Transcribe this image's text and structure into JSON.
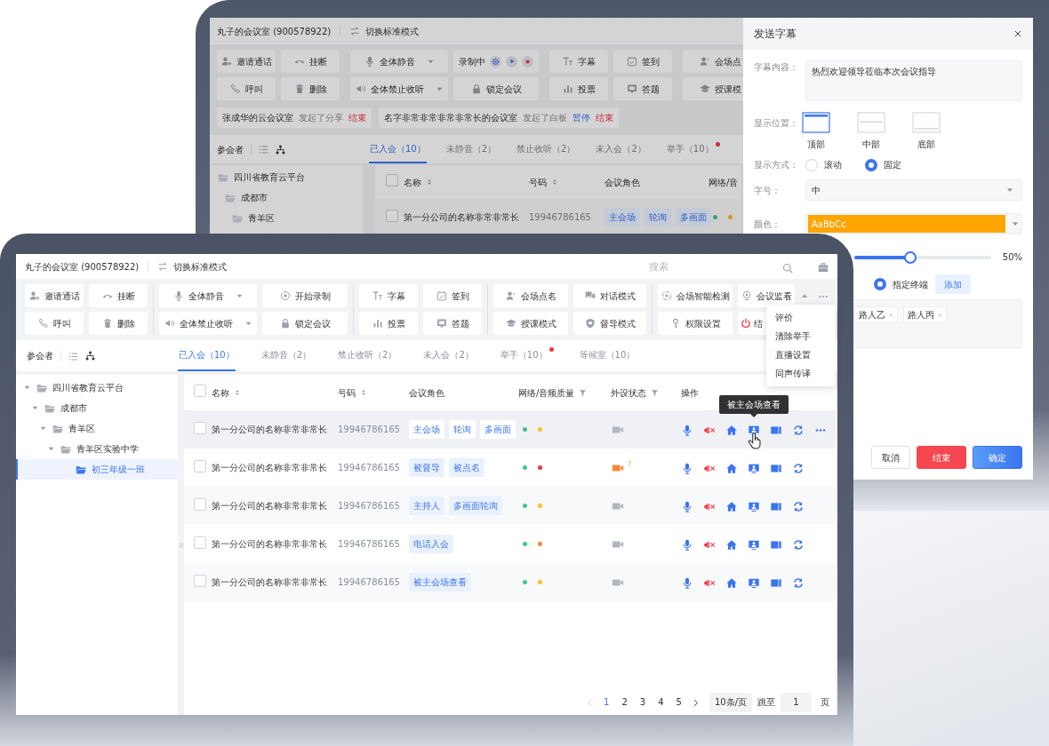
{
  "back_window": {
    "title": "丸子的会议室 (900578922)",
    "mode_switch": "切换标准模式",
    "toolbar": [
      {
        "rows": [
          [
            {
              "label": "邀请通话",
              "kind": "plain"
            },
            {
              "label": "挂断",
              "kind": "plain"
            }
          ],
          [
            {
              "label": "呼叫",
              "kind": "plain"
            },
            {
              "label": "删除",
              "kind": "plain"
            }
          ]
        ]
      },
      {
        "rows": [
          [
            {
              "label": "全体静音",
              "kind": "dropdown"
            },
            {
              "label": "录制中",
              "kind": "recording"
            }
          ],
          [
            {
              "label": "全体禁止收听",
              "kind": "dropdown"
            },
            {
              "label": "锁定会议",
              "kind": "plain"
            }
          ]
        ]
      },
      {
        "rows": [
          [
            {
              "label": "字幕",
              "kind": "plain"
            },
            {
              "label": "签到",
              "kind": "plain"
            }
          ],
          [
            {
              "label": "投票",
              "kind": "plain"
            },
            {
              "label": "答题",
              "kind": "plain"
            }
          ]
        ]
      },
      {
        "rows": [
          [
            {
              "label": "会场点",
              "kind": "plain"
            }
          ],
          [
            {
              "label": "授课模",
              "kind": "plain"
            }
          ]
        ]
      }
    ],
    "notices": [
      {
        "parts": [
          {
            "text": "张成华的云会议室",
            "kind": "name"
          },
          {
            "text": "发起了分享",
            "kind": "action"
          },
          {
            "text": "结束",
            "kind": "danger"
          }
        ]
      },
      {
        "parts": [
          {
            "text": "名字非常非常非常非常长的会议室",
            "kind": "name"
          },
          {
            "text": "发起了白板",
            "kind": "action"
          },
          {
            "text": "暂停",
            "kind": "link"
          },
          {
            "text": "结束",
            "kind": "danger"
          }
        ]
      }
    ],
    "participants_label": "参会者",
    "tabs": [
      {
        "label": "已入会（10）",
        "selected": true,
        "dot": false
      },
      {
        "label": "未静音（2）",
        "selected": false,
        "dot": false
      },
      {
        "label": "禁止收听（2）",
        "selected": false,
        "dot": false
      },
      {
        "label": "未入会（2）",
        "selected": false,
        "dot": false
      },
      {
        "label": "举手（10）",
        "selected": false,
        "dot": true
      }
    ],
    "tree": [
      {
        "label": "四川省教育云平台",
        "selected": false,
        "children": [
          {
            "label": "成都市",
            "selected": false,
            "children": [
              {
                "label": "青羊区",
                "selected": false
              }
            ]
          }
        ]
      }
    ],
    "table": {
      "all_checked": false,
      "columns": [
        {
          "label": "名称",
          "sort": true,
          "filter": false
        },
        {
          "label": "号码",
          "sort": true,
          "filter": false
        },
        {
          "label": "会议角色",
          "sort": false,
          "filter": false
        },
        {
          "label": "网络/音",
          "sort": false,
          "filter": false
        }
      ],
      "rows": [
        {
          "checked": false,
          "name": "第一分公司的名称非常非常长",
          "number": "19946786165",
          "roles": [
            "主会场",
            "轮询",
            "多画面"
          ],
          "quality": [
            {
              "color": "#33a474"
            },
            {
              "color": "#cf9c1c"
            }
          ]
        }
      ]
    },
    "drawer": {
      "title": "发送字幕",
      "content": {
        "label": "字幕内容：",
        "value": "热烈欢迎领导莅临本次会议指导"
      },
      "position": {
        "label": "显示位置：",
        "options": [
          {
            "label": "顶部",
            "selected": true
          },
          {
            "label": "中部",
            "selected": false
          },
          {
            "label": "底部",
            "selected": false
          }
        ]
      },
      "mode": {
        "label": "显示方式：",
        "options": [
          {
            "label": "滚动",
            "selected": false
          },
          {
            "label": "固定",
            "selected": true
          }
        ]
      },
      "size": {
        "label": "字号：",
        "value": "中"
      },
      "color": {
        "label": "颜色：",
        "value": "AaBbCc",
        "color": "#ffa500"
      },
      "opacity": {
        "level": 0.41,
        "reading": "50%"
      },
      "target": {
        "options": [
          {
            "label": "指定终端",
            "selected": true
          }
        ],
        "add": "添加"
      },
      "recipients": [
        {
          "label": "路人乙"
        },
        {
          "label": "路人丙"
        }
      ],
      "buttons": [
        {
          "label": "取消",
          "kind": "default"
        },
        {
          "label": "结束",
          "kind": "danger"
        },
        {
          "label": "确定",
          "kind": "primary"
        }
      ]
    }
  },
  "front_window": {
    "title": "丸子的会议室 (900578922)",
    "mode_switch": "切换标准模式",
    "search": {
      "placeholder": "搜索"
    },
    "toolbar": [
      {
        "rows": [
          [
            {
              "label": "邀请通话",
              "kind": "plain"
            },
            {
              "label": "挂断",
              "kind": "plain"
            }
          ],
          [
            {
              "label": "呼叫",
              "kind": "plain"
            },
            {
              "label": "删除",
              "kind": "plain"
            }
          ]
        ]
      },
      {
        "rows": [
          [
            {
              "label": "全体静音",
              "kind": "dropdown"
            },
            {
              "label": "开始录制",
              "kind": "plain"
            }
          ],
          [
            {
              "label": "全体禁止收听",
              "kind": "dropdown"
            },
            {
              "label": "锁定会议",
              "kind": "plain"
            }
          ]
        ]
      },
      {
        "rows": [
          [
            {
              "label": "字幕",
              "kind": "plain"
            },
            {
              "label": "签到",
              "kind": "plain"
            }
          ],
          [
            {
              "label": "投票",
              "kind": "plain"
            },
            {
              "label": "答题",
              "kind": "plain"
            }
          ]
        ]
      },
      {
        "rows": [
          [
            {
              "label": "会场点名",
              "kind": "plain"
            },
            {
              "label": "对话模式",
              "kind": "plain"
            }
          ],
          [
            {
              "label": "授课模式",
              "kind": "plain"
            },
            {
              "label": "督导模式",
              "kind": "plain"
            }
          ]
        ]
      },
      {
        "rows": [
          [
            {
              "label": "会场智能检测",
              "kind": "plain"
            },
            {
              "label": "会议监看",
              "kind": "plain"
            }
          ],
          [
            {
              "label": "权限设置",
              "kind": "plain"
            },
            {
              "label": "结",
              "kind": "danger"
            }
          ]
        ]
      }
    ],
    "more_menu": [
      "评价",
      "清除举手",
      "直播设置",
      "同声传译"
    ],
    "participants_label": "参会者",
    "tabs": [
      {
        "label": "已入会（10）",
        "selected": true,
        "dot": false
      },
      {
        "label": "未静音（2）",
        "selected": false,
        "dot": false
      },
      {
        "label": "禁止收听（2）",
        "selected": false,
        "dot": false
      },
      {
        "label": "未入会（2）",
        "selected": false,
        "dot": false
      },
      {
        "label": "举手（10）",
        "selected": false,
        "dot": true
      },
      {
        "label": "等候室（10）",
        "selected": false,
        "dot": false
      }
    ],
    "tree": [
      {
        "label": "四川省教育云平台",
        "expanded": true,
        "selected": false,
        "children": [
          {
            "label": "成都市",
            "expanded": true,
            "selected": false,
            "children": [
              {
                "label": "青羊区",
                "expanded": true,
                "selected": false,
                "children": [
                  {
                    "label": "青羊区实验中学",
                    "expanded": true,
                    "selected": false,
                    "children": [
                      {
                        "label": "初三年级一班",
                        "selected": true
                      }
                    ]
                  }
                ]
              }
            ]
          }
        ]
      }
    ],
    "table": {
      "all_checked": false,
      "columns": [
        {
          "label": "名称",
          "sort": true,
          "filter": false
        },
        {
          "label": "号码",
          "sort": true,
          "filter": false
        },
        {
          "label": "会议角色",
          "sort": false,
          "filter": false
        },
        {
          "label": "网络/音频质量",
          "sort": false,
          "filter": true
        },
        {
          "label": "外设状态",
          "sort": false,
          "filter": true
        },
        {
          "label": "操作",
          "sort": false,
          "filter": false
        }
      ],
      "rows": [
        {
          "checked": false,
          "hovered": true,
          "name": "第一分公司的名称非常非常长",
          "number": "19946786165",
          "roles": [
            "主会场",
            "轮询",
            "多画面"
          ],
          "quality": [
            {
              "color": "#3ec48c"
            },
            {
              "color": "#fbc02d"
            }
          ],
          "camera_warning": false
        },
        {
          "checked": false,
          "hovered": false,
          "name": "第一分公司的名称非常非常长",
          "number": "19946786165",
          "roles": [
            "被督导",
            "被点名"
          ],
          "quality": [
            {
              "color": "#3ec48c"
            },
            {
              "color": "#f5333f"
            }
          ],
          "camera_warning": true,
          "camera_note": "?"
        },
        {
          "checked": false,
          "hovered": false,
          "name": "第一分公司的名称非常非常长",
          "number": "19946786165",
          "roles": [
            "主持人",
            "多画面轮询"
          ],
          "quality": [
            {
              "color": "#3ec48c"
            },
            {
              "color": "#fbc02d"
            }
          ],
          "camera_warning": false
        },
        {
          "checked": false,
          "hovered": false,
          "name": "第一分公司的名称非常非常长",
          "number": "19946786165",
          "roles": [
            "电话入会"
          ],
          "quality": [
            {
              "color": "#3ec48c"
            },
            {
              "color": "#f7873a"
            }
          ],
          "camera_warning": false
        },
        {
          "checked": false,
          "hovered": false,
          "name": "第一分公司的名称非常非常长",
          "number": "19946786165",
          "roles": [
            "被主会场查看"
          ],
          "quality": [
            {
              "color": "#3ec48c"
            },
            {
              "color": "#fbc02d"
            }
          ],
          "camera_warning": false
        }
      ]
    },
    "tooltip": "被主会场查看",
    "pagination": {
      "pages": [
        {
          "label": "1",
          "selected": true
        },
        {
          "label": "2",
          "selected": false
        },
        {
          "label": "3",
          "selected": false
        },
        {
          "label": "4",
          "selected": false
        },
        {
          "label": "5",
          "selected": false
        }
      ],
      "page_size": "10条/页",
      "jump_label": "跳至",
      "jump_value": "1",
      "unit": "页"
    }
  }
}
